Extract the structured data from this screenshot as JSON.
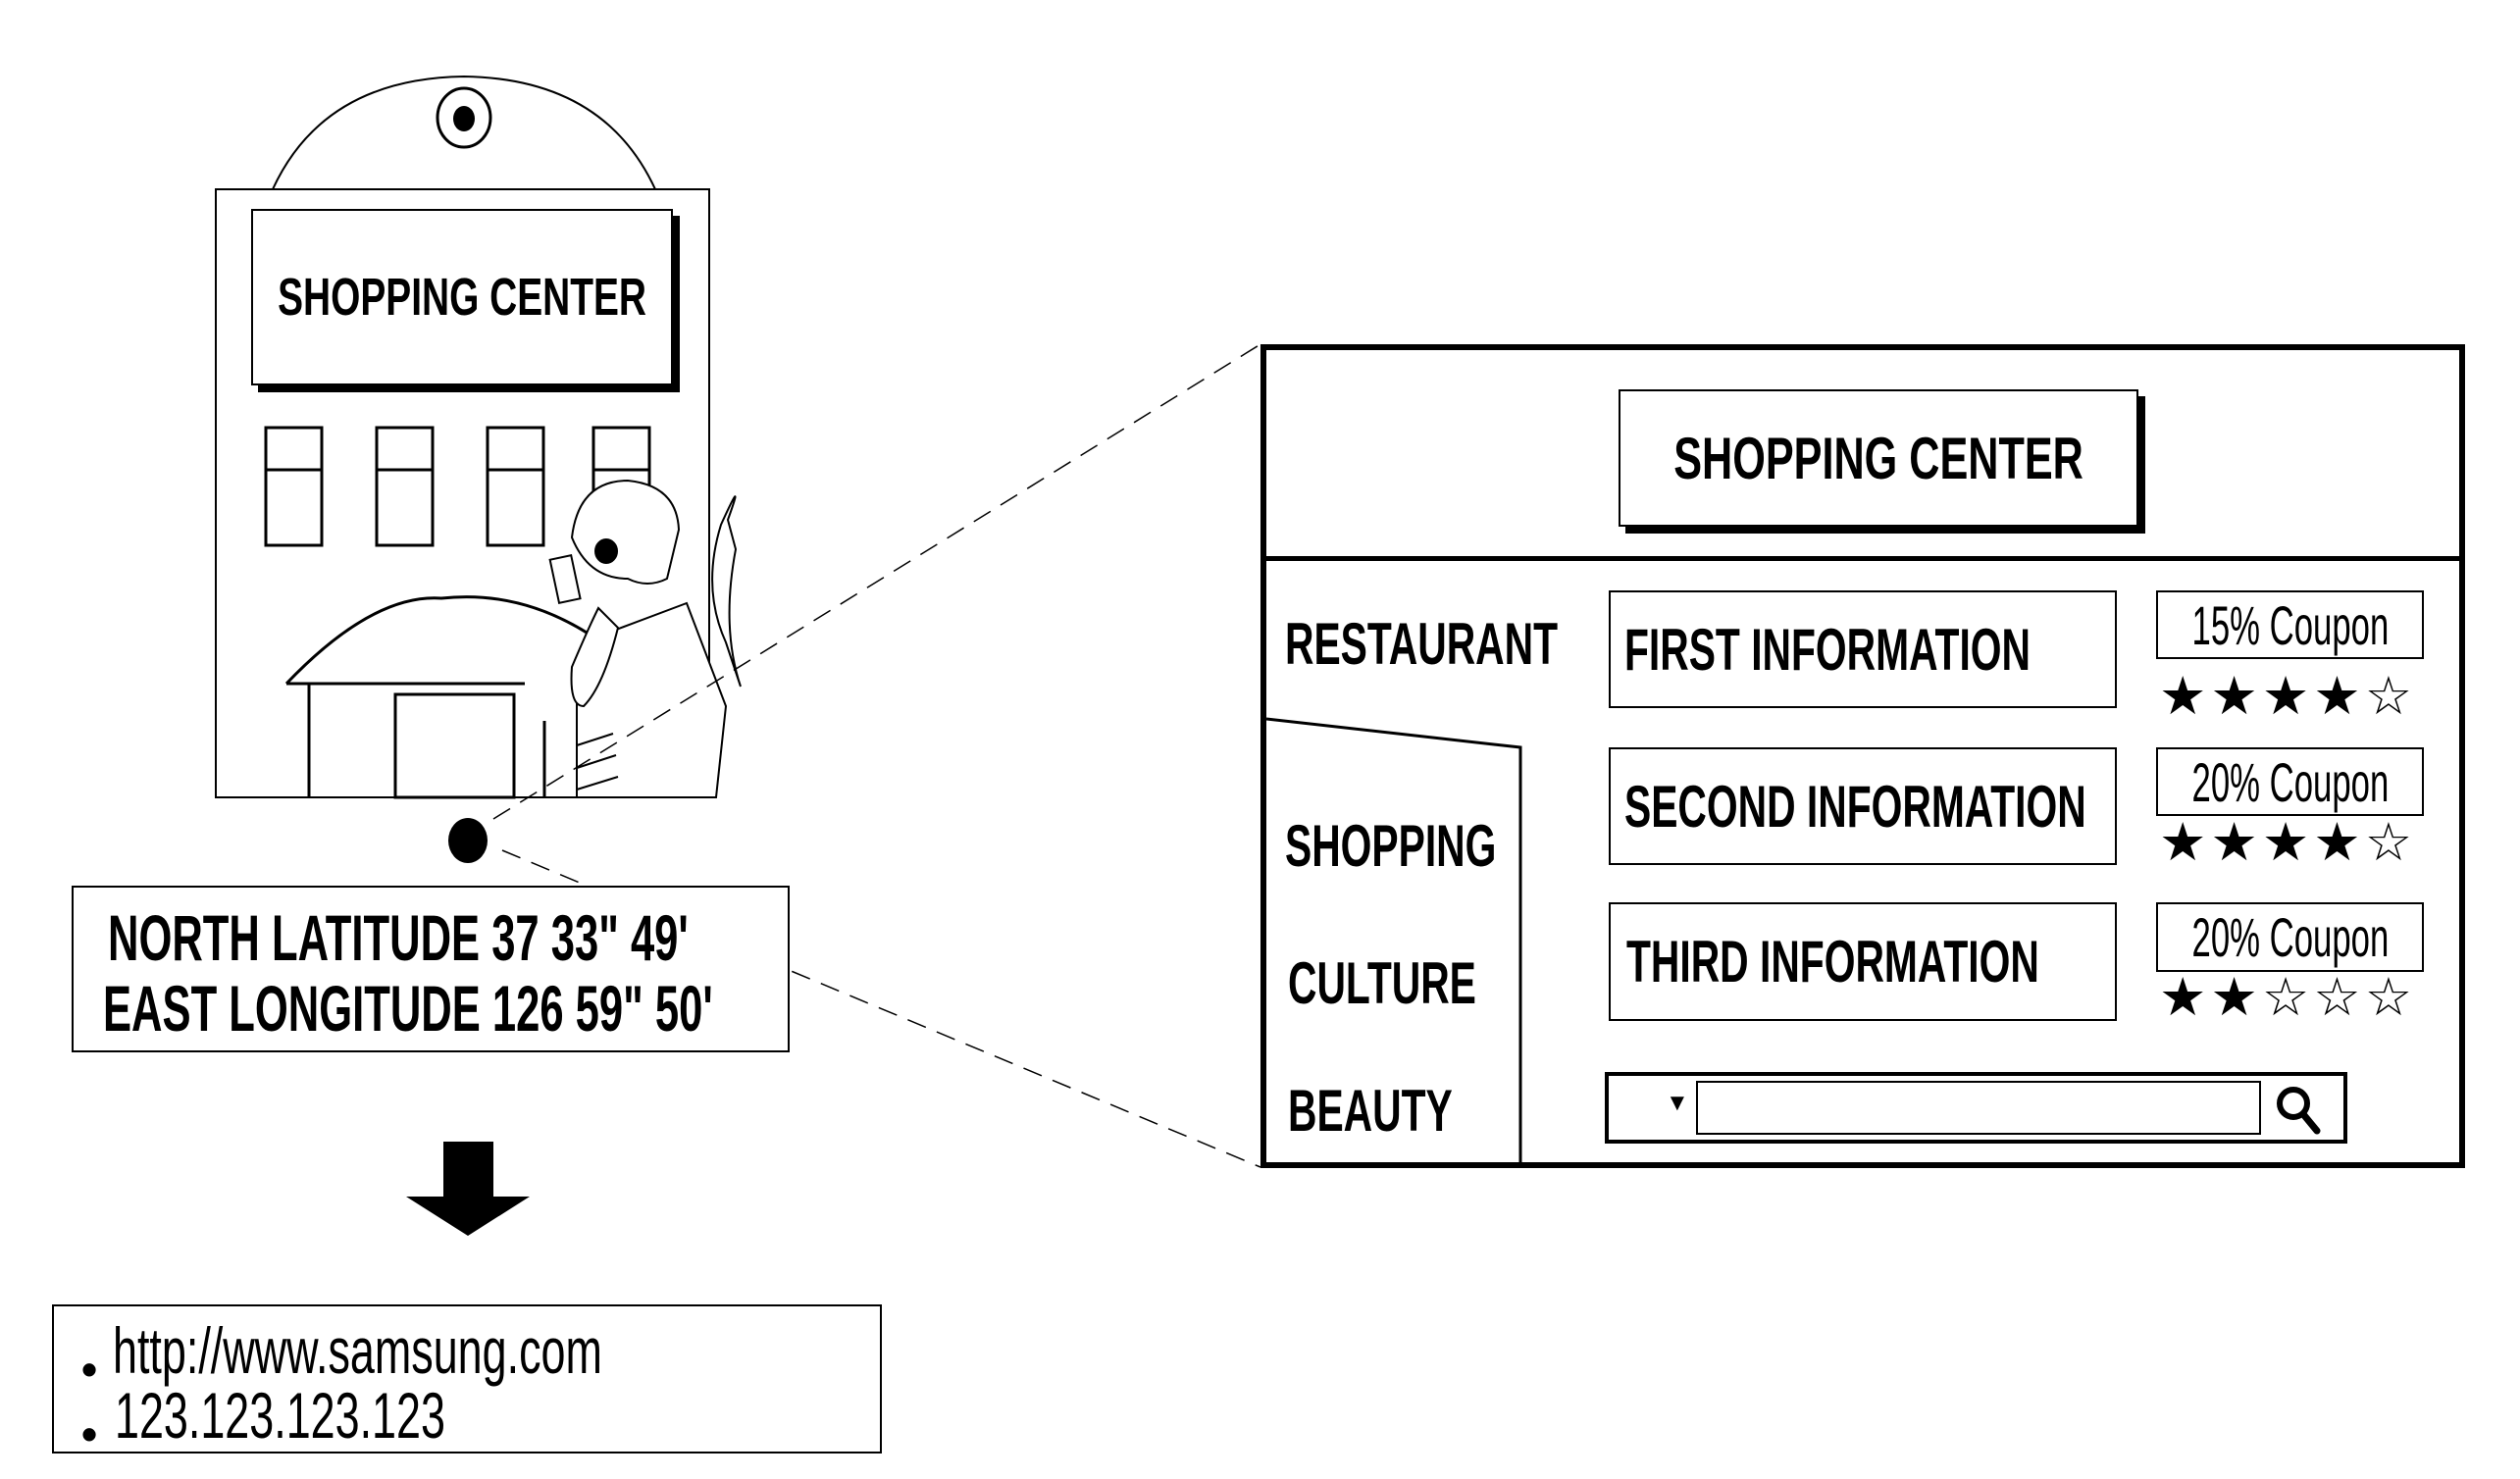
{
  "building": {
    "sign_text": "SHOPPING CENTER"
  },
  "location": {
    "latitude_text": "NORTH LATITUDE 37 33\" 49'",
    "longitude_text": "EAST LONGITUDE 126 59\" 50'"
  },
  "result": {
    "items": [
      {
        "bullet": "•",
        "text": "http://www.samsung.com"
      },
      {
        "bullet": "•",
        "text": "123.123.123.123"
      }
    ]
  },
  "panel": {
    "header_title": "SHOPPING CENTER",
    "categories": [
      {
        "label": "RESTAURANT",
        "selected": true
      },
      {
        "label": "SHOPPING",
        "selected": false
      },
      {
        "label": "CULTURE",
        "selected": false
      },
      {
        "label": "BEAUTY",
        "selected": false
      }
    ],
    "entries": [
      {
        "info": "FIRST INFORMATION",
        "coupon": "15% Coupon",
        "rating": 4,
        "max_rating": 5
      },
      {
        "info": "SECOND INFORMATION",
        "coupon": "20% Coupon",
        "rating": 4,
        "max_rating": 5
      },
      {
        "info": "THIRD INFORMATION",
        "coupon": "20% Coupon",
        "rating": 2,
        "max_rating": 5
      }
    ],
    "search": {
      "dropdown_icon": "▼",
      "value": "",
      "placeholder": "",
      "search_icon": "magnifier"
    },
    "star_glyphs": {
      "full": "★",
      "empty": "☆"
    }
  }
}
